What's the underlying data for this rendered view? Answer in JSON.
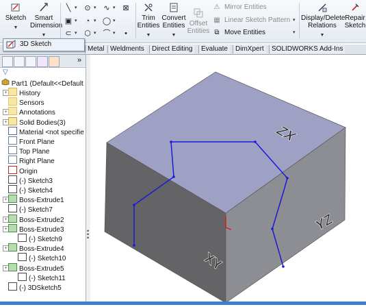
{
  "ribbon": {
    "sketch": "Sketch",
    "smart_dimension": [
      "Smart",
      "Dimension"
    ],
    "trim": [
      "Trim",
      "Entities"
    ],
    "convert": [
      "Convert",
      "Entities"
    ],
    "offset": [
      "Offset",
      "Entities"
    ],
    "mirror": "Mirror Entities",
    "linear_pattern": "Linear Sketch Pattern",
    "move": "Move Entities",
    "display_delete": [
      "Display/Delete",
      "Relations"
    ],
    "repair": [
      "Repair",
      "Sketch"
    ]
  },
  "popup": {
    "label": "3D Sketch"
  },
  "tabs": [
    "Metal",
    "Weldments",
    "Direct Editing",
    "Evaluate",
    "DimXpert",
    "SOLIDWORKS Add-Ins"
  ],
  "tree": {
    "root": "Part1  (Default<<Default",
    "items": [
      "History",
      "Sensors",
      "Annotations",
      "Solid Bodies(3)",
      "Material <not specifie",
      "Front Plane",
      "Top Plane",
      "Right Plane",
      "Origin",
      "(-) Sketch3",
      "(-) Sketch4",
      "Boss-Extrude1",
      "(-) Sketch7",
      "Boss-Extrude2",
      "Boss-Extrude3",
      "(-) Sketch9",
      "Boss-Extrude4",
      "(-) Sketch10",
      "Boss-Extrude5",
      "(-) Sketch11",
      "(-) 3DSketch5"
    ]
  },
  "model": {
    "labels": [
      "ZX",
      "YZ",
      "XY"
    ]
  },
  "colors": {
    "top_face": "#9ea0c4",
    "left_face": "#646466",
    "right_face": "#8d8e93",
    "sketch": "#1a1ad6"
  }
}
